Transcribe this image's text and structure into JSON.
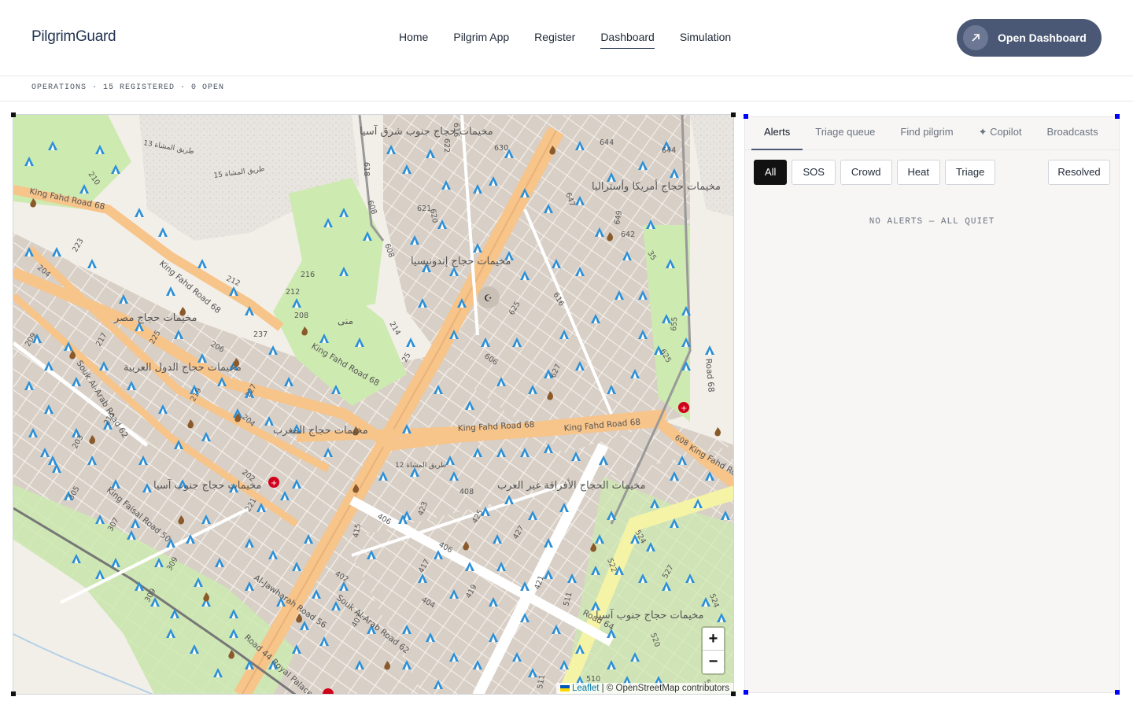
{
  "header": {
    "logo": "PilgrimGuard",
    "nav": [
      {
        "label": "Home",
        "active": false
      },
      {
        "label": "Pilgrim App",
        "active": false
      },
      {
        "label": "Register",
        "active": false
      },
      {
        "label": "Dashboard",
        "active": true
      },
      {
        "label": "Simulation",
        "active": false
      }
    ],
    "cta_label": "Open Dashboard",
    "cta_icon": "arrow-up-right-icon"
  },
  "status_strip": "OPERATIONS · 15 REGISTERED · 0 OPEN",
  "map": {
    "labels": {
      "kfr1": "King Fahd Road 68",
      "kfr2": "King Fahd Road 68",
      "kfr3": "King Fahd Road 68",
      "kfr4": "King Fahd Road 68",
      "kfr5": "King Fahd Road 68",
      "kfr6": "King Fahd Road",
      "souk1": "Souk Al-Arab Road 62",
      "souk2": "Souk Al-Arab Road 62",
      "faisal": "King Faisal Road 50",
      "jawharah": "Al-Jawharah Road 56",
      "royal": "Road 44 Royal Palace",
      "road68": "Road 68",
      "road64": "Road 64",
      "road12": "طريق المشاة 12",
      "road13": "طريق المشاة 13",
      "road15": "طريق المشاة 15",
      "mina": "منى",
      "camp_asia_east": "مخيمات حجاج جنوب شرق آسيا",
      "camp_america": "مخيمات حجاج أمريكا وأستراليا",
      "camp_indonesia": "مخيمات حجاج إندونيسيا",
      "camp_egypt": "مخيمات حجاج مصر",
      "camp_arab": "مخيمات حجاج الدول العربية",
      "camp_maghreb": "مخيمات حجاج المغرب",
      "camp_south_asia": "مخيمات حجاج جنوب آسيا",
      "camp_africa": "مخيمات الحجاج الأفراقة غير العرب",
      "camp_south_asia2": "مخيمات حجاج جنوب آسيا",
      "n630": "630",
      "n644": "644",
      "n644b": "644",
      "n647": "647",
      "n649": "649",
      "n642": "642",
      "n616": "616",
      "n622": "622",
      "n618": "618",
      "n608": "608",
      "n608b": "608",
      "n621": "621",
      "n620": "620",
      "n625": "625",
      "n627": "627",
      "n606": "606",
      "n616b": "616",
      "n608c": "608",
      "n212": "212",
      "n216": "216",
      "n212b": "212",
      "n208": "208",
      "n214": "214",
      "n237": "237",
      "n206": "206",
      "n225": "225",
      "n217": "217",
      "n209": "209",
      "n204": "204",
      "n223": "223",
      "n210": "210",
      "n204b": "204",
      "n227": "227",
      "n219": "219",
      "n211": "211",
      "n203": "203",
      "n202": "202",
      "n221": "221",
      "n305": "305",
      "n307": "307",
      "n309": "309",
      "n309b": "309",
      "n408": "408",
      "n406": "406",
      "n406b": "406",
      "n415": "415",
      "n423": "423",
      "n425": "425",
      "n427": "427",
      "n417": "417",
      "n402": "402",
      "n404": "404",
      "n419": "419",
      "n421": "421",
      "n407": "407",
      "n524": "524",
      "n522": "522",
      "n527": "527",
      "n524b": "524",
      "n520": "520",
      "n510": "510",
      "n511": "511",
      "n511b": "511",
      "n522b": "522",
      "n625b": "625",
      "n655": "655",
      "n25": "25",
      "n35": "35"
    },
    "zoom_in": "+",
    "zoom_out": "−",
    "attribution_link": "Leaflet",
    "attribution_text": "| © OpenStreetMap contributors"
  },
  "panel": {
    "tabs": [
      {
        "label": "Alerts",
        "active": true
      },
      {
        "label": "Triage queue",
        "active": false
      },
      {
        "label": "Find pilgrim",
        "active": false
      },
      {
        "label": "✦ Copilot",
        "active": false
      },
      {
        "label": "Broadcasts",
        "active": false
      }
    ],
    "filters": [
      {
        "label": "All",
        "active": true
      },
      {
        "label": "SOS",
        "active": false
      },
      {
        "label": "Crowd",
        "active": false
      },
      {
        "label": "Heat",
        "active": false
      },
      {
        "label": "Triage",
        "active": false
      }
    ],
    "resolved_label": "Resolved",
    "empty_message": "NO ALERTS — ALL QUIET"
  },
  "colors": {
    "accent": "#4a5875",
    "map_motorway": "#f7c48a",
    "map_green": "#cdeab0",
    "tent_icon": "#2b8fd6",
    "hospital": "#d0021b"
  }
}
